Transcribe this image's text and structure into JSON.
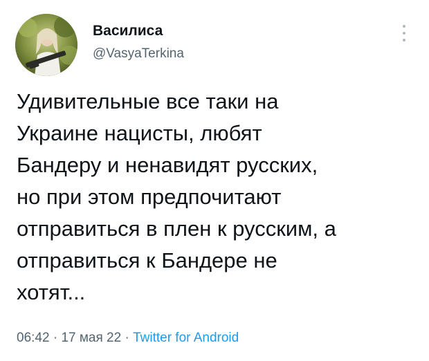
{
  "author": {
    "name": "Василиса",
    "handle": "@VasyaTerkina",
    "avatar_icon": "profile-photo"
  },
  "more_icon": "vertical-ellipsis-icon",
  "tweet_lines": [
    "Удивительные все таки на",
    "Украине нацисты, любят",
    "Бандеру и ненавидят русских,",
    "но при этом предпочитают",
    "отправиться в плен к русским, а",
    "отправиться к Бандере не",
    "хотят..."
  ],
  "meta": {
    "time": "06:42",
    "separator": "·",
    "date": "17 мая 22",
    "source": "Twitter for Android"
  },
  "colors": {
    "text": "#0f1419",
    "secondary": "#536471",
    "link": "#1d9bf0"
  }
}
